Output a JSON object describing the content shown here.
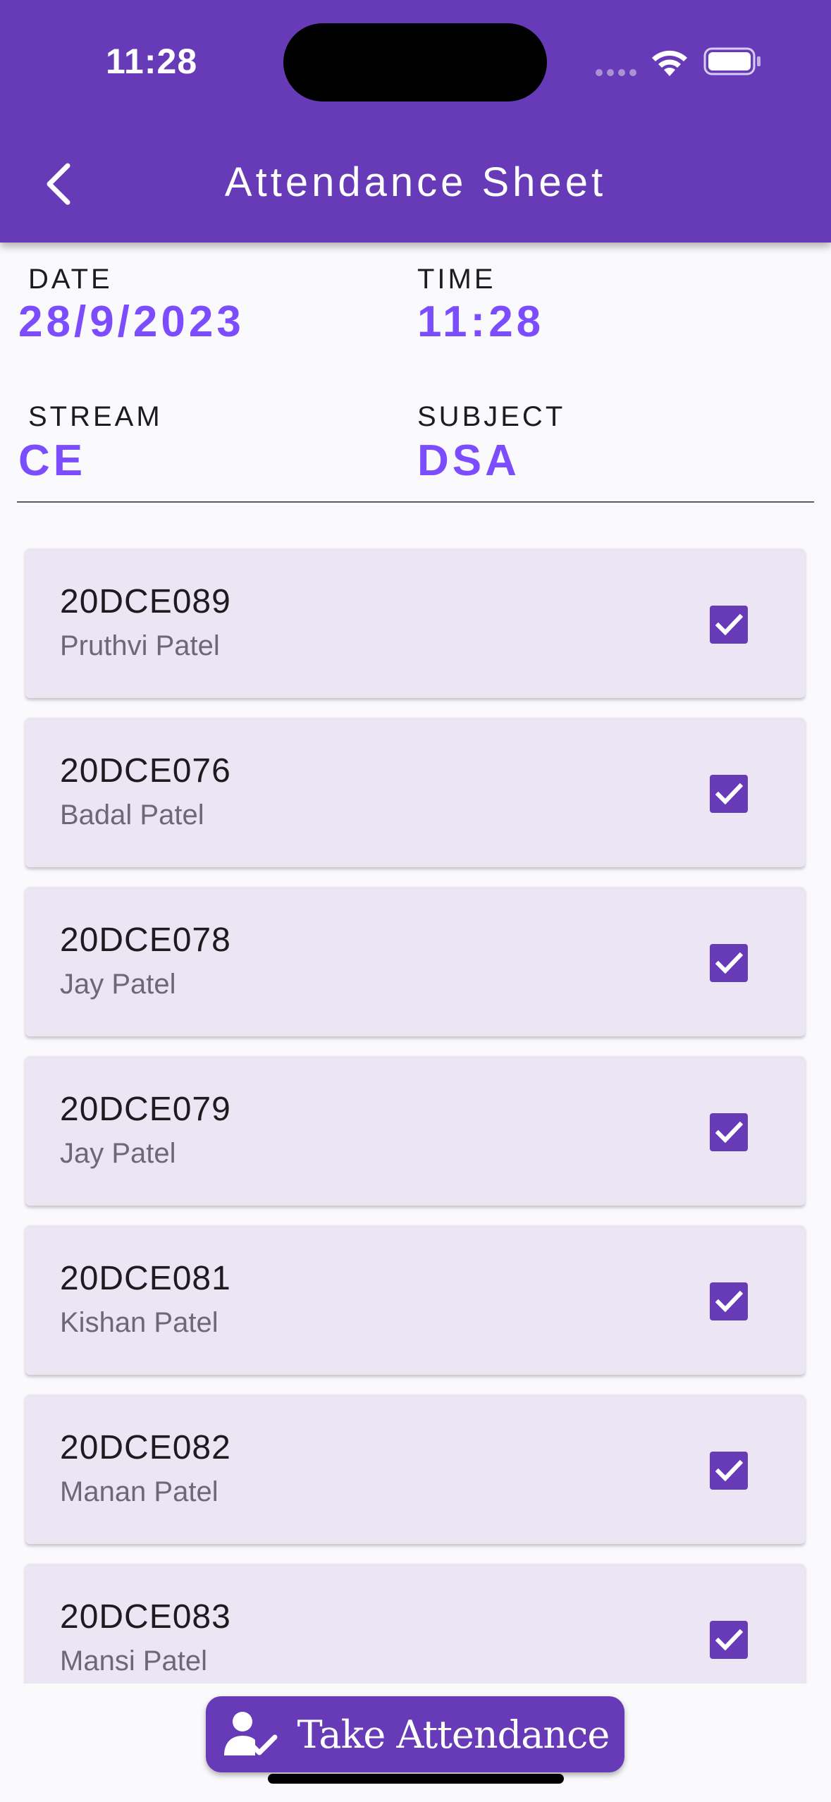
{
  "status_bar": {
    "time": "11:28"
  },
  "header": {
    "title": "Attendance Sheet"
  },
  "info": {
    "date_label": "DATE",
    "date_value": "28/9/2023",
    "time_label": "TIME",
    "time_value": "11:28",
    "stream_label": "STREAM",
    "stream_value": "CE",
    "subject_label": "SUBJECT",
    "subject_value": "DSA"
  },
  "students": [
    {
      "id": "20DCE089",
      "name": "Pruthvi Patel",
      "present": true
    },
    {
      "id": "20DCE076",
      "name": "Badal Patel",
      "present": true
    },
    {
      "id": "20DCE078",
      "name": "Jay Patel",
      "present": true
    },
    {
      "id": "20DCE079",
      "name": "Jay Patel",
      "present": true
    },
    {
      "id": "20DCE081",
      "name": "Kishan Patel",
      "present": true
    },
    {
      "id": "20DCE082",
      "name": "Manan Patel",
      "present": true
    },
    {
      "id": "20DCE083",
      "name": "Mansi Patel",
      "present": true
    }
  ],
  "actions": {
    "take_attendance_label": "Take Attendance"
  },
  "colors": {
    "primary": "#673AB7",
    "accent": "#7C4DFF",
    "card": "#ECE6F4",
    "background": "#FAF9FB"
  },
  "icons": {
    "back": "chevron-left-icon",
    "check": "checkbox-checked-icon",
    "take_attendance": "person-check-icon"
  }
}
